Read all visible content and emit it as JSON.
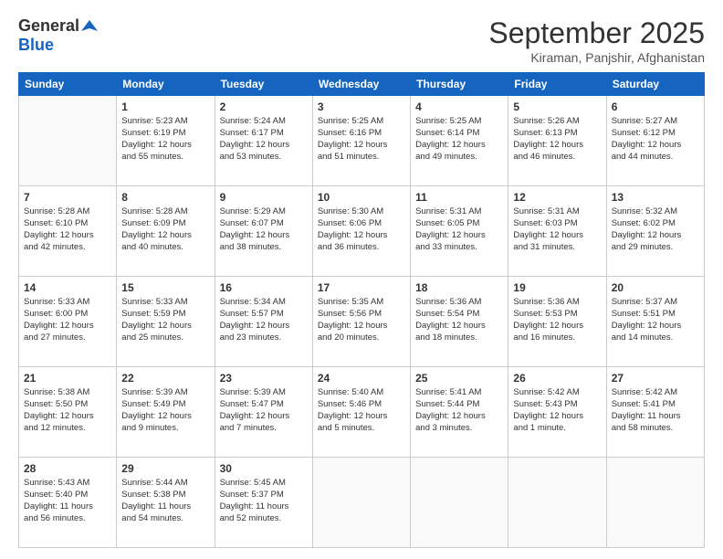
{
  "header": {
    "logo_line1": "General",
    "logo_line2": "Blue",
    "month": "September 2025",
    "location": "Kiraman, Panjshir, Afghanistan"
  },
  "days_of_week": [
    "Sunday",
    "Monday",
    "Tuesday",
    "Wednesday",
    "Thursday",
    "Friday",
    "Saturday"
  ],
  "weeks": [
    [
      {
        "day": "",
        "info": ""
      },
      {
        "day": "1",
        "info": "Sunrise: 5:23 AM\nSunset: 6:19 PM\nDaylight: 12 hours\nand 55 minutes."
      },
      {
        "day": "2",
        "info": "Sunrise: 5:24 AM\nSunset: 6:17 PM\nDaylight: 12 hours\nand 53 minutes."
      },
      {
        "day": "3",
        "info": "Sunrise: 5:25 AM\nSunset: 6:16 PM\nDaylight: 12 hours\nand 51 minutes."
      },
      {
        "day": "4",
        "info": "Sunrise: 5:25 AM\nSunset: 6:14 PM\nDaylight: 12 hours\nand 49 minutes."
      },
      {
        "day": "5",
        "info": "Sunrise: 5:26 AM\nSunset: 6:13 PM\nDaylight: 12 hours\nand 46 minutes."
      },
      {
        "day": "6",
        "info": "Sunrise: 5:27 AM\nSunset: 6:12 PM\nDaylight: 12 hours\nand 44 minutes."
      }
    ],
    [
      {
        "day": "7",
        "info": "Sunrise: 5:28 AM\nSunset: 6:10 PM\nDaylight: 12 hours\nand 42 minutes."
      },
      {
        "day": "8",
        "info": "Sunrise: 5:28 AM\nSunset: 6:09 PM\nDaylight: 12 hours\nand 40 minutes."
      },
      {
        "day": "9",
        "info": "Sunrise: 5:29 AM\nSunset: 6:07 PM\nDaylight: 12 hours\nand 38 minutes."
      },
      {
        "day": "10",
        "info": "Sunrise: 5:30 AM\nSunset: 6:06 PM\nDaylight: 12 hours\nand 36 minutes."
      },
      {
        "day": "11",
        "info": "Sunrise: 5:31 AM\nSunset: 6:05 PM\nDaylight: 12 hours\nand 33 minutes."
      },
      {
        "day": "12",
        "info": "Sunrise: 5:31 AM\nSunset: 6:03 PM\nDaylight: 12 hours\nand 31 minutes."
      },
      {
        "day": "13",
        "info": "Sunrise: 5:32 AM\nSunset: 6:02 PM\nDaylight: 12 hours\nand 29 minutes."
      }
    ],
    [
      {
        "day": "14",
        "info": "Sunrise: 5:33 AM\nSunset: 6:00 PM\nDaylight: 12 hours\nand 27 minutes."
      },
      {
        "day": "15",
        "info": "Sunrise: 5:33 AM\nSunset: 5:59 PM\nDaylight: 12 hours\nand 25 minutes."
      },
      {
        "day": "16",
        "info": "Sunrise: 5:34 AM\nSunset: 5:57 PM\nDaylight: 12 hours\nand 23 minutes."
      },
      {
        "day": "17",
        "info": "Sunrise: 5:35 AM\nSunset: 5:56 PM\nDaylight: 12 hours\nand 20 minutes."
      },
      {
        "day": "18",
        "info": "Sunrise: 5:36 AM\nSunset: 5:54 PM\nDaylight: 12 hours\nand 18 minutes."
      },
      {
        "day": "19",
        "info": "Sunrise: 5:36 AM\nSunset: 5:53 PM\nDaylight: 12 hours\nand 16 minutes."
      },
      {
        "day": "20",
        "info": "Sunrise: 5:37 AM\nSunset: 5:51 PM\nDaylight: 12 hours\nand 14 minutes."
      }
    ],
    [
      {
        "day": "21",
        "info": "Sunrise: 5:38 AM\nSunset: 5:50 PM\nDaylight: 12 hours\nand 12 minutes."
      },
      {
        "day": "22",
        "info": "Sunrise: 5:39 AM\nSunset: 5:49 PM\nDaylight: 12 hours\nand 9 minutes."
      },
      {
        "day": "23",
        "info": "Sunrise: 5:39 AM\nSunset: 5:47 PM\nDaylight: 12 hours\nand 7 minutes."
      },
      {
        "day": "24",
        "info": "Sunrise: 5:40 AM\nSunset: 5:46 PM\nDaylight: 12 hours\nand 5 minutes."
      },
      {
        "day": "25",
        "info": "Sunrise: 5:41 AM\nSunset: 5:44 PM\nDaylight: 12 hours\nand 3 minutes."
      },
      {
        "day": "26",
        "info": "Sunrise: 5:42 AM\nSunset: 5:43 PM\nDaylight: 12 hours\nand 1 minute."
      },
      {
        "day": "27",
        "info": "Sunrise: 5:42 AM\nSunset: 5:41 PM\nDaylight: 11 hours\nand 58 minutes."
      }
    ],
    [
      {
        "day": "28",
        "info": "Sunrise: 5:43 AM\nSunset: 5:40 PM\nDaylight: 11 hours\nand 56 minutes."
      },
      {
        "day": "29",
        "info": "Sunrise: 5:44 AM\nSunset: 5:38 PM\nDaylight: 11 hours\nand 54 minutes."
      },
      {
        "day": "30",
        "info": "Sunrise: 5:45 AM\nSunset: 5:37 PM\nDaylight: 11 hours\nand 52 minutes."
      },
      {
        "day": "",
        "info": ""
      },
      {
        "day": "",
        "info": ""
      },
      {
        "day": "",
        "info": ""
      },
      {
        "day": "",
        "info": ""
      }
    ]
  ]
}
